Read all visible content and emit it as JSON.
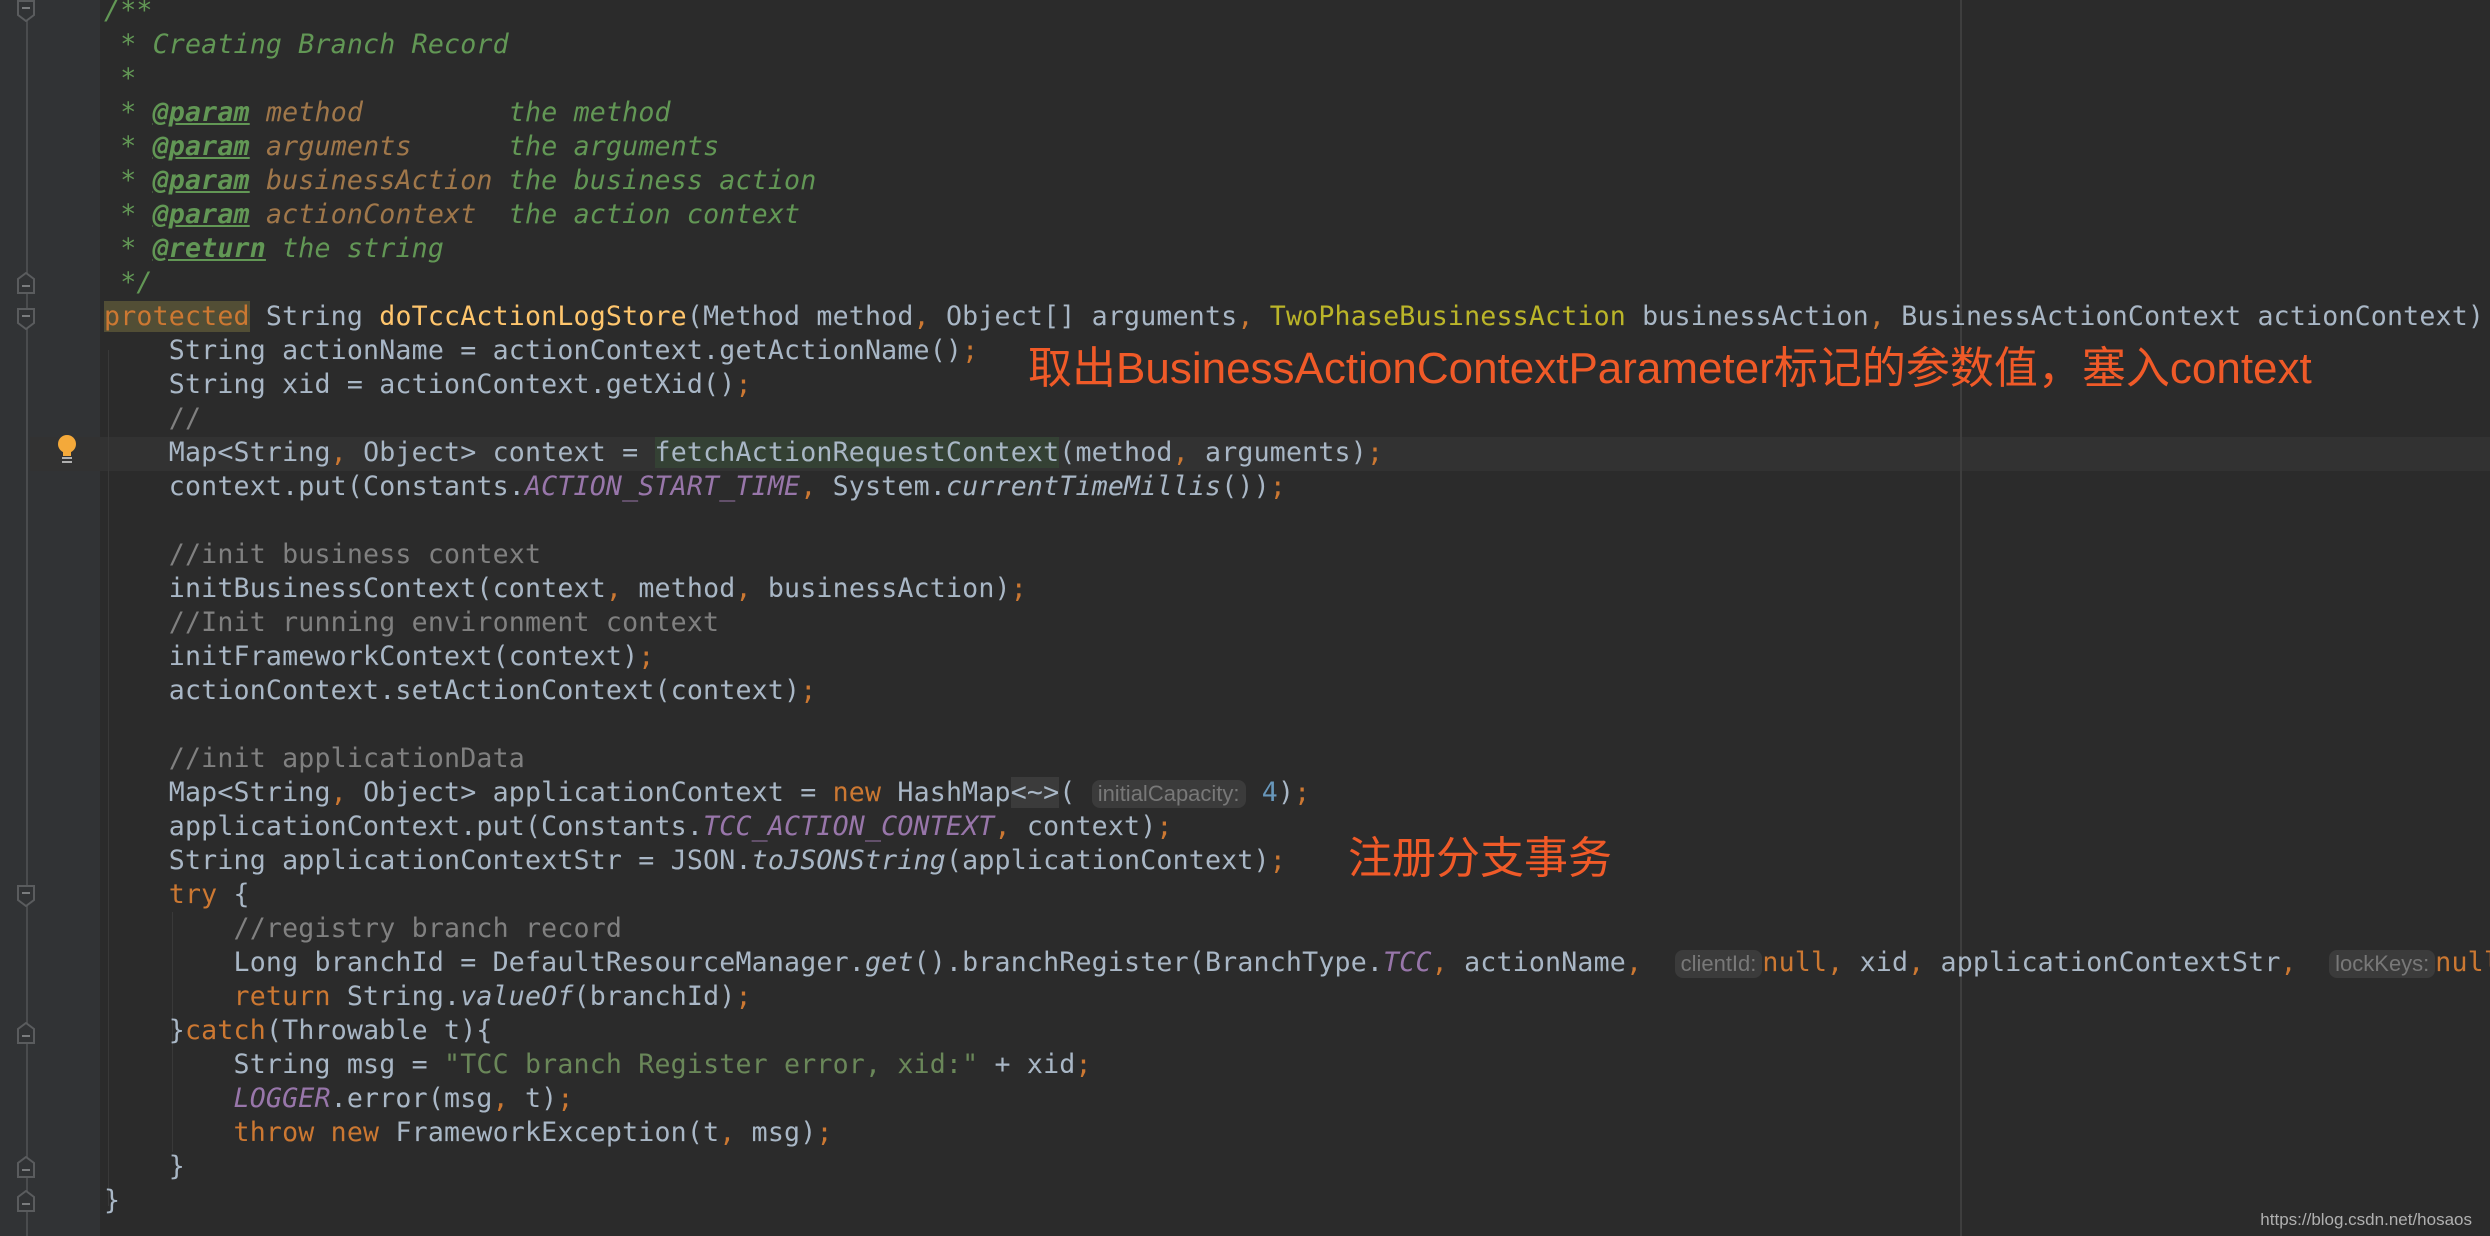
{
  "editor": {
    "language": "java",
    "method_name": "doTccActionLogStore",
    "javadoc": {
      "open": "/**",
      "summary": " * Creating Branch Record",
      "blank": " *",
      "params": [
        {
          "prefix": " * ",
          "tag": "@param",
          "name": "method",
          "pad": "        ",
          "desc": " the method"
        },
        {
          "prefix": " * ",
          "tag": "@param",
          "name": "arguments",
          "pad": "     ",
          "desc": " the arguments"
        },
        {
          "prefix": " * ",
          "tag": "@param",
          "name": "businessAction",
          "pad": "",
          "desc": " the business action"
        },
        {
          "prefix": " * ",
          "tag": "@param",
          "name": "actionContext",
          "pad": " ",
          "desc": " the action context"
        }
      ],
      "return_prefix": " * ",
      "return_tag": "@return",
      "return_desc": " the string",
      "close": " */"
    },
    "signature": {
      "modifier": "protected",
      "return_type": " String ",
      "name": "doTccActionLogStore",
      "p1": "(Method method",
      "p2": " Object[] arguments",
      "p3_type": "TwoPhaseBusinessAction",
      "p3_name": " businessAction",
      "p4": " BusinessActionContext actionContext) {"
    },
    "lines": {
      "action_name": "    String actionName = actionContext.getActionName()",
      "xid": "    String xid = actionContext.getXid()",
      "empty_comment": "    //",
      "map_ctx_a": "    Map<String",
      "map_ctx_b": " Object> context = ",
      "fetch_fn": "fetchActionRequestContext",
      "fetch_args_a": "(method",
      "fetch_args_b": " arguments)",
      "put_a": "    context.put(Constants.",
      "put_const": "ACTION_START_TIME",
      "put_b": " System.",
      "put_fn": "currentTimeMillis",
      "put_c": "())",
      "c_init_business": "    //init business context",
      "init_business_a": "    initBusinessContext(context",
      "init_business_b": " method",
      "init_business_c": " businessAction)",
      "c_init_running": "    //Init running environment context",
      "init_framework": "    initFrameworkContext(context)",
      "set_ctx": "    actionContext.setActionContext(context)",
      "c_init_app": "    //init applicationData",
      "app_map_a": "    Map<String",
      "app_map_b": " Object> applicationContext = ",
      "app_map_new": "new",
      "app_map_c": " HashMap",
      "app_map_diamond": "<~>",
      "app_map_paren": "( ",
      "app_map_hint": "initialCapacity:",
      "app_map_num": "4",
      "app_map_end": ")",
      "app_put_a": "    applicationContext.put(Constants.",
      "app_put_const": "TCC_ACTION_CONTEXT",
      "app_put_b": " context)",
      "app_str_a": "    String applicationContextStr = JSON.",
      "app_str_fn": "toJSONString",
      "app_str_b": "(applicationContext)",
      "try_kw": "    try",
      "try_b": " {",
      "c_registry": "        //registry branch record",
      "reg_a": "        Long branchId = DefaultResourceManager.",
      "reg_get": "get",
      "reg_b": "().branchRegister(BranchType.",
      "reg_tcc": "TCC",
      "reg_c": " actionName",
      "reg_hint1": "clientId:",
      "reg_null": "null",
      "reg_d": " xid",
      "reg_e": " applicationContextStr",
      "reg_hint2": "lockKeys:",
      "reg_null2": "null",
      "ret_kw": "        return",
      "ret_a": " String.",
      "ret_fn": "valueOf",
      "ret_b": "(branchId)",
      "catch_a": "    }",
      "catch_kw": "catch",
      "catch_b": "(Throwable t){",
      "msg_a": "        String msg = ",
      "msg_str": "\"TCC branch Register error, xid:\"",
      "msg_b": " + xid",
      "logger": "        LOGGER",
      "logger_b": ".error(msg",
      "logger_c": " t)",
      "throw_kw": "        throw",
      "throw_new": " new",
      "throw_b": " FrameworkException(t",
      "throw_c": " msg)",
      "close_catch": "    }",
      "close_method": "}"
    },
    "punct": {
      "comma": ",",
      "semi": ";"
    }
  },
  "annotations": {
    "fetch_note": "取出BusinessActionContextParameter标记的参数值，塞入context",
    "register_note": "注册分支事务",
    "color": "#f05a28"
  },
  "watermark": "https://blog.csdn.net/hosaos"
}
